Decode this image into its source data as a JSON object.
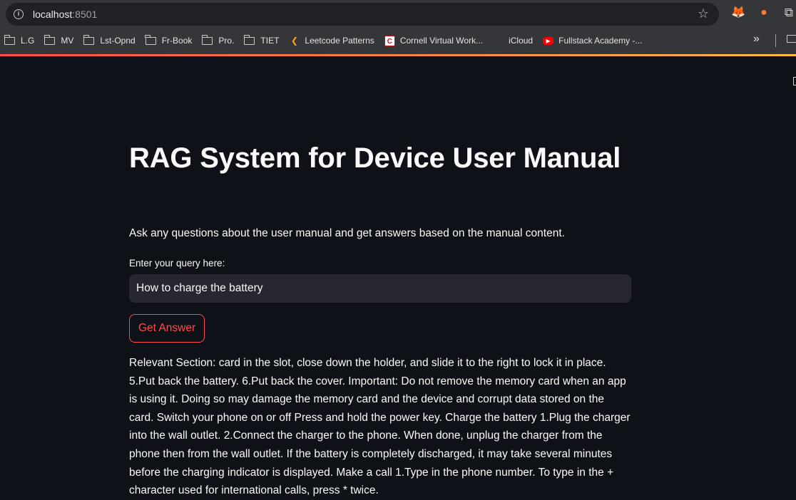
{
  "browser": {
    "url_host": "localhost",
    "url_port": ":8501",
    "bookmarks": [
      {
        "label": "L.G",
        "icon": "folder-icon"
      },
      {
        "label": "MV",
        "icon": "folder-icon"
      },
      {
        "label": "Lst-Opnd",
        "icon": "folder-icon"
      },
      {
        "label": "Fr-Book",
        "icon": "folder-icon"
      },
      {
        "label": "Pro.",
        "icon": "folder-icon"
      },
      {
        "label": "TIET",
        "icon": "folder-icon"
      },
      {
        "label": "Leetcode Patterns",
        "icon": "leetcode-icon"
      },
      {
        "label": "Cornell Virtual Work...",
        "icon": "cornell-icon"
      },
      {
        "label": "iCloud",
        "icon": "apple-icon"
      },
      {
        "label": "Fullstack Academy -...",
        "icon": "youtube-icon"
      }
    ]
  },
  "app": {
    "title": "RAG System for Device User Manual",
    "subtitle": "Ask any questions about the user manual and get answers based on the manual content.",
    "query_label": "Enter your query here:",
    "query_value": "How to charge the battery",
    "button_label": "Get Answer",
    "answer_text": "Relevant Section: card in the slot, close down the holder, and slide it to the right to lock it in place. 5.Put back the battery. 6.Put back the cover. Important: Do not remove the memory card when an app is using it. Doing so may damage the memory card and the device and corrupt data stored on the card. Switch your phone on or off Press and hold the power key. Charge the battery 1.Plug the charger into the wall outlet. 2.Connect the charger to the phone. When done, unplug the charger from the phone then from the wall outlet. If the battery is completely discharged, it may take several minutes before the charging indicator is displayed. Make a call 1.Type in the phone number. To type in the + character used for international calls, press * twice."
  },
  "colors": {
    "background": "#0e1117",
    "accent": "#ff4b4b",
    "input_bg": "#262730",
    "chrome": "#35363a"
  }
}
